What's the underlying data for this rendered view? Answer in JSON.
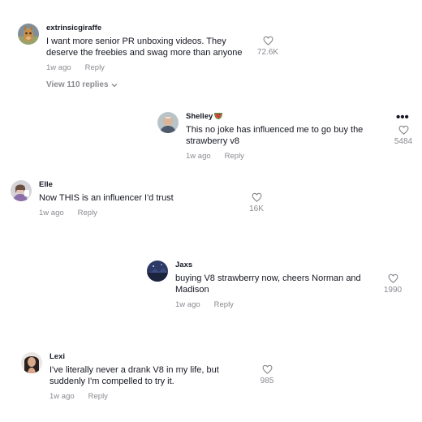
{
  "comments": [
    {
      "username": "extrinsicgiraffe",
      "text": "I want more senior PR unboxing videos. They deserve the freebies and swag more than anyone",
      "time": "1w ago",
      "reply_label": "Reply",
      "likes": "72.6K",
      "view_replies": "View 110 replies"
    },
    {
      "username": "Shelley",
      "user_emoji": "watermelon-emoji",
      "text": "This no joke has influenced me to go buy the strawberry v8",
      "time": "1w ago",
      "reply_label": "Reply",
      "likes": "5484"
    },
    {
      "username": "Elle",
      "text": "Now THIS is an influencer I'd trust",
      "time": "1w ago",
      "reply_label": "Reply",
      "likes": "16K"
    },
    {
      "username": "Jaxs",
      "text": "buying V8 strawberry now, cheers Norman and Madison",
      "time": "1w ago",
      "reply_label": "Reply",
      "likes": "1990"
    },
    {
      "username": "Lexi",
      "text": "I've literally never a drank V8 in my life, but suddenly I'm compelled to try it.",
      "time": "1w ago",
      "reply_label": "Reply",
      "likes": "985"
    }
  ],
  "icons": {
    "like": "heart-outline-icon",
    "more": "more-options-icon",
    "expand": "chevron-down-icon"
  },
  "colors": {
    "text": "#161823",
    "secondary": "#8a8b91"
  }
}
